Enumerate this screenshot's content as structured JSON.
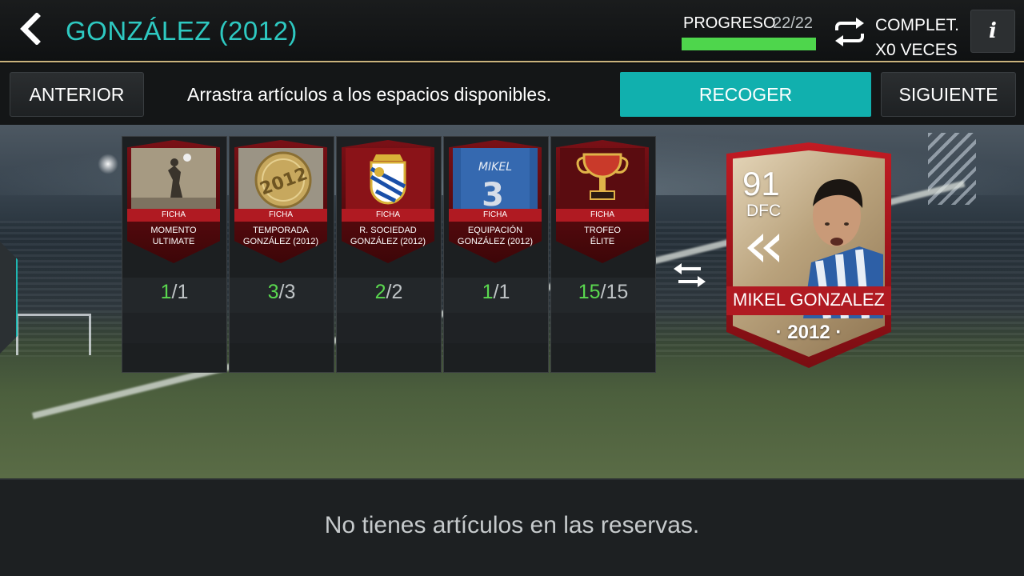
{
  "header": {
    "title": "GONZÁLEZ (2012)",
    "progress_label": "PROGRESO",
    "progress_count": "22/22",
    "progress_fraction": 1.0,
    "completed_line1": "COMPLET.",
    "completed_line2": "X0 VECES",
    "info_label": "i"
  },
  "actions": {
    "prev_label": "ANTERIOR",
    "instruction": "Arrastra artículos a los espacios disponibles.",
    "collect_label": "RECOGER",
    "next_label": "SIGUIENTE"
  },
  "slots": [
    {
      "tag": "FICHA",
      "name1": "MOMENTO",
      "name2": "ULTIMATE",
      "have": "1",
      "sep": "/",
      "need": "1"
    },
    {
      "tag": "FICHA",
      "name1": "TEMPORADA",
      "name2": "GONZÁLEZ (2012)",
      "have": "3",
      "sep": "/",
      "need": "3",
      "art_text": "2012"
    },
    {
      "tag": "FICHA",
      "name1": "R. SOCIEDAD",
      "name2": "GONZÁLEZ (2012)",
      "have": "2",
      "sep": "/",
      "need": "2"
    },
    {
      "tag": "FICHA",
      "name1": "EQUIPACIÓN",
      "name2": "GONZÁLEZ (2012)",
      "have": "1",
      "sep": "/",
      "need": "1",
      "art_text": "MIKEL"
    },
    {
      "tag": "FICHA",
      "name1": "TROFEO",
      "name2": "ÉLITE",
      "have": "15",
      "sep": "/",
      "need": "15"
    }
  ],
  "reward": {
    "rating": "91",
    "position": "DFC",
    "name": "MIKEL GONZALEZ",
    "year": "· 2012 ·"
  },
  "reserve": {
    "message": "No tienes artículos en las reservas."
  },
  "colors": {
    "accent": "#2ec9c1",
    "button_primary": "#11b0ae",
    "progress": "#4ed64c",
    "count_have": "#5ad84f",
    "card_red": "#b01a22"
  },
  "icons": {
    "back": "chevron-left-icon",
    "repeat": "repeat-icon",
    "info": "info-icon",
    "swap": "swap-arrows-icon",
    "rewind": "rewind-icon"
  }
}
